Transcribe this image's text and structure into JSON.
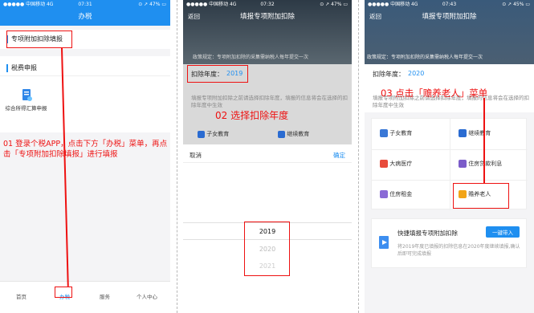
{
  "p1": {
    "status": {
      "left": "●●●●● 中国移动  4G",
      "time": "07:31",
      "right": "⊙ ↗ 47% ▭"
    },
    "title": "办税",
    "sec1": "专项附加扣除填报",
    "sec2": "税费申报",
    "item": "综合所得汇算申报",
    "anno": "01 登录个税APP，点击下方「办税」菜单，再点击「专项附加扣除填报」进行填报",
    "tabs": [
      "首页",
      "办税",
      "服务",
      "个人中心"
    ]
  },
  "p2": {
    "status": {
      "left": "●●●●● 中国移动  4G",
      "time": "07:32",
      "right": "⊙ ↗ 47% ▭"
    },
    "back": "返回",
    "title": "填报专项附加扣除",
    "policy": "政策规定：专项附加扣除的采集需纳税人每年提交一次",
    "year_label": "扣除年度：",
    "year_value": "2019",
    "hint": "填报专项附加扣除之前请选择扣除年度，填报的信息将会在选择的扣除年度中生效",
    "anno": "02 选择扣除年度",
    "items": [
      "子女教育",
      "继续教育"
    ],
    "cancel": "取消",
    "ok": "确定",
    "options": [
      "2019",
      "2020",
      "2021"
    ]
  },
  "p3": {
    "status": {
      "left": "●●●●● 中国移动  4G",
      "time": "07:43",
      "right": "⊙ ↗ 45% ▭"
    },
    "back": "返回",
    "title": "填报专项附加扣除",
    "policy": "政策规定：专项附加扣除的采集需纳税人每年提交一次",
    "year_label": "扣除年度：",
    "year_value": "2020",
    "hint": "填报专项附加扣除之前请选择扣除年度，填报的信息将会在选择的扣除年度中生效",
    "anno": "03 点击「赡养老人」菜单",
    "items": [
      "子女教育",
      "继续教育",
      "大病医疗",
      "住房贷款利息",
      "住房租金",
      "赡养老人"
    ],
    "quick_title": "快捷填报专项附加扣除",
    "quick_btn": "一键带入",
    "quick_desc": "将2019年度已填报的扣除信息在2020年度继续填报,确认后即可完成填报"
  },
  "colors": {
    "brand": "#1f8ff0",
    "annotation": "#ee1111"
  }
}
